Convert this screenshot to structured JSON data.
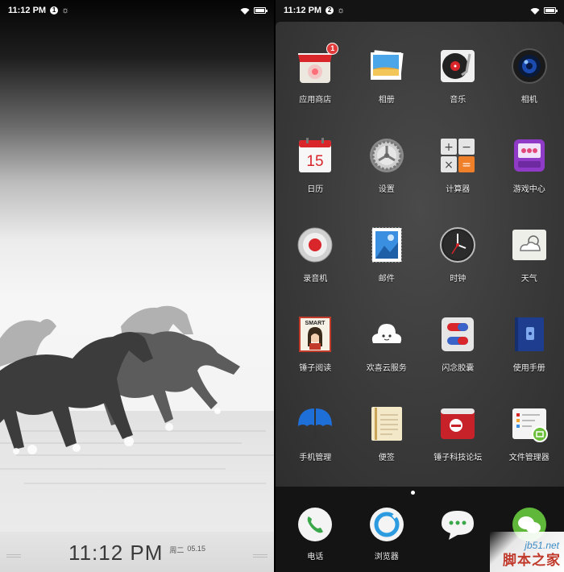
{
  "lock_screen": {
    "status": {
      "time": "11:12 PM",
      "badge": "1"
    },
    "time": "11:12 PM",
    "weekday": "周二",
    "date": "05.15"
  },
  "home_screen": {
    "status": {
      "time": "11:12 PM",
      "badge": "2"
    },
    "rows": [
      [
        {
          "label": "应用商店",
          "icon": "app-store-icon",
          "badge": "1"
        },
        {
          "label": "相册",
          "icon": "photos-icon"
        },
        {
          "label": "音乐",
          "icon": "music-record-icon"
        },
        {
          "label": "相机",
          "icon": "camera-lens-icon"
        }
      ],
      [
        {
          "label": "日历",
          "icon": "calendar-icon",
          "day": "15"
        },
        {
          "label": "设置",
          "icon": "settings-gear-icon"
        },
        {
          "label": "计算器",
          "icon": "calculator-icon",
          "keys": [
            "+",
            "−",
            "×",
            "="
          ]
        },
        {
          "label": "游戏中心",
          "icon": "game-center-icon"
        }
      ],
      [
        {
          "label": "录音机",
          "icon": "recorder-icon"
        },
        {
          "label": "邮件",
          "icon": "mail-stamp-icon"
        },
        {
          "label": "时钟",
          "icon": "clock-icon"
        },
        {
          "label": "天气",
          "icon": "weather-icon"
        }
      ],
      [
        {
          "label": "锤子阅读",
          "icon": "smart-reader-icon",
          "tag": "SMART"
        },
        {
          "label": "欢喜云服务",
          "icon": "cloud-service-icon"
        },
        {
          "label": "闪念胶囊",
          "icon": "capsule-icon"
        },
        {
          "label": "使用手册",
          "icon": "manual-book-icon"
        }
      ],
      [
        {
          "label": "手机管理",
          "icon": "umbrella-icon"
        },
        {
          "label": "便签",
          "icon": "notes-icon"
        },
        {
          "label": "锤子科技论坛",
          "icon": "forum-icon"
        },
        {
          "label": "文件管理器",
          "icon": "file-manager-icon"
        }
      ]
    ],
    "dock": [
      {
        "label": "电话",
        "icon": "phone-icon"
      },
      {
        "label": "浏览器",
        "icon": "browser-icon"
      },
      {
        "label": "",
        "icon": "messages-icon"
      },
      {
        "label": "",
        "icon": "wechat-icon"
      }
    ],
    "watermark": {
      "site": "jb51.net",
      "name": "脚本之家"
    }
  },
  "colors": {
    "accent_red": "#e13a3a",
    "panel": "#3a3a3a",
    "lock_text": "#3a3a3a"
  }
}
